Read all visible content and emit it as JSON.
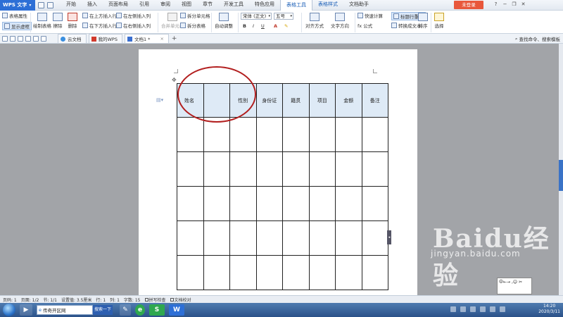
{
  "app": {
    "logo": "WPS 文字",
    "menu": [
      "开始",
      "插入",
      "页面布局",
      "引用",
      "审阅",
      "视图",
      "章节",
      "开发工具",
      "特色应用",
      "表格工具",
      "表格样式",
      "文档助手"
    ],
    "active_menu": "表格工具",
    "login_label": "未登录",
    "window_controls": [
      "?",
      "−",
      "❐",
      "✕"
    ]
  },
  "ribbon": {
    "table_props": "表格属性",
    "show_gridlines": "显示虚框",
    "draw_table": "绘制表格",
    "erase": "擦除",
    "delete": "删除",
    "summary": "汇总",
    "insert_row_above": "在上方插入行",
    "insert_row_below": "在下方插入行",
    "insert_col_left": "在左侧插入列",
    "insert_col_right": "在右侧插入列",
    "merge_cells": "合并单元格",
    "split_cells": "拆分单元格",
    "split_table": "拆分表格",
    "auto_fit": "自动调整",
    "font_name": "宋体 (正文)",
    "font_size": "五号",
    "bold": "B",
    "italic": "I",
    "underline": "U",
    "align": "对齐方式",
    "text_direction": "文字方向",
    "quick_calc": "快速计算",
    "formula": "fx 公式",
    "repeat_header": "标题行重复",
    "convert_text": "转换成文本",
    "sort": "排序",
    "select": "选择"
  },
  "tabs": {
    "cloud": "云文档",
    "mywps": "我的WPS",
    "doc": "文档1 *",
    "command_search": "查找命令、搜索模板"
  },
  "document": {
    "table_headers": [
      "姓名",
      "",
      "性别",
      "身份证",
      "籍贯",
      "项目",
      "金额",
      "备注"
    ],
    "empty_rows": 5
  },
  "watermark": {
    "brand": "Baidu经验",
    "url": "jingyan.baidu.com"
  },
  "popup_text": "中←→ ,☺ ✂",
  "status": {
    "page_no": "页码: 1",
    "pages": "页面: 1/2",
    "section": "节: 1/1",
    "setting": "设置值: 3.5厘米",
    "row": "行: 1",
    "col": "列: 1",
    "words": "字数: 15",
    "spell": "拼写检查",
    "proof": "文档校对"
  },
  "taskbar": {
    "ie_text": "传奇开区网",
    "search_label": "搜索一下",
    "time": "14:20",
    "date": "2020/3/11"
  },
  "colors": {
    "wps_blue": "#2d6fd6",
    "header_fill": "#deeaf6",
    "annotation_red": "#b21e1e",
    "login_red": "#e8573b"
  }
}
